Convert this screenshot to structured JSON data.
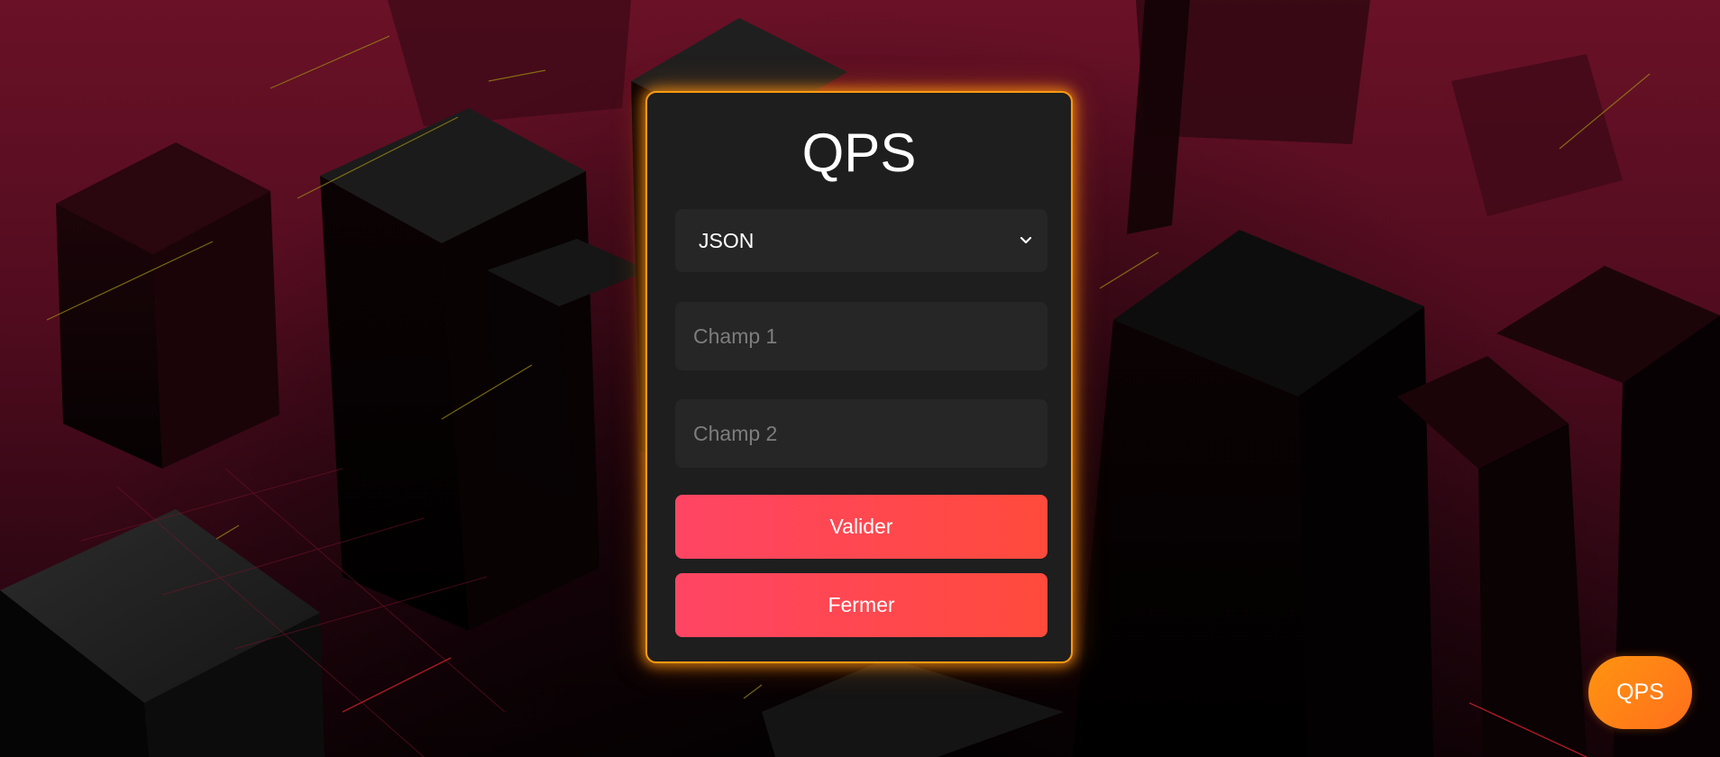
{
  "modal": {
    "title": "QPS",
    "format_select": {
      "selected": "JSON"
    },
    "field1": {
      "value": "",
      "placeholder": "Champ 1"
    },
    "field2": {
      "value": "",
      "placeholder": "Champ 2"
    },
    "validate_label": "Valider",
    "close_label": "Fermer"
  },
  "floating_button": {
    "label": "QPS"
  },
  "icons": {
    "select_arrow": "chevron-down-icon"
  },
  "colors": {
    "accent_border": "#ff9a10",
    "button_gradient_start": "#ff4564",
    "button_gradient_end": "#ff4a3c",
    "fab_gradient_start": "#ff9410",
    "fab_gradient_end": "#ff6f1c",
    "panel_background": "#1e1e1e",
    "input_background": "#262626",
    "background_crimson": "#5a0d22"
  }
}
